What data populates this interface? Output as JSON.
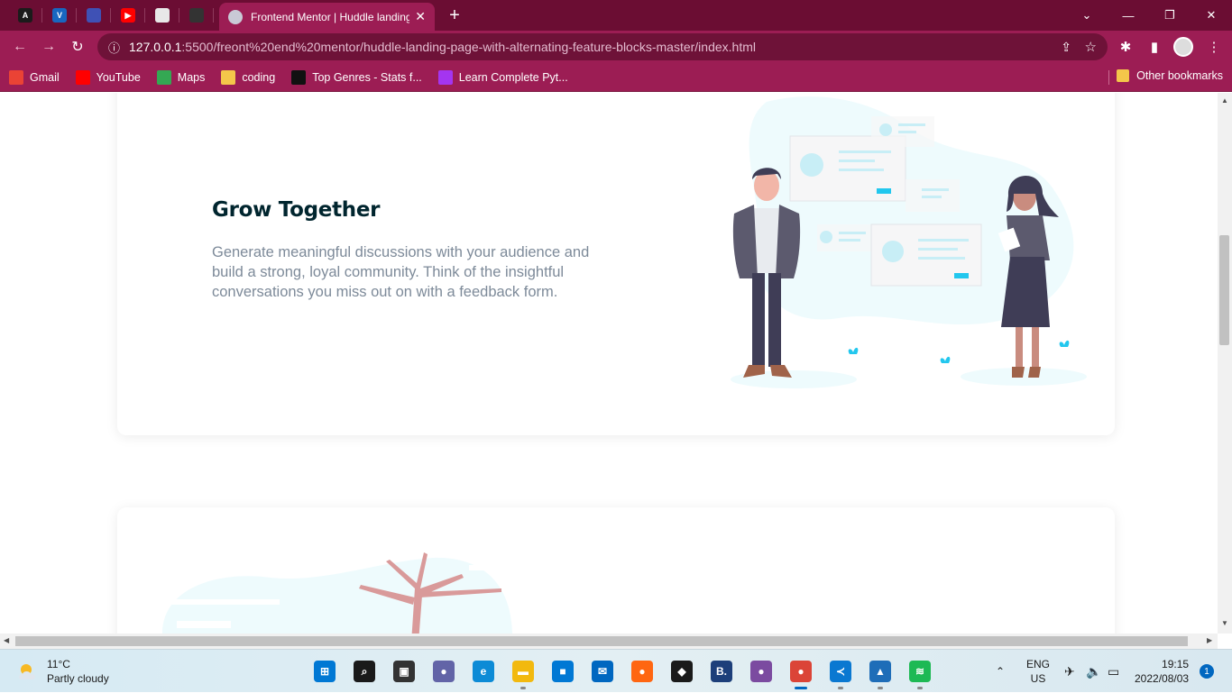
{
  "browser": {
    "active_tab": {
      "title": "Frontend Mentor | Huddle landing page with alternating feature blocks"
    },
    "pinned_tabs": [
      {
        "icon": "angular-icon",
        "color": "#1b1b1b",
        "glyph": "A"
      },
      {
        "icon": "vuetify-icon",
        "color": "#1867c0",
        "glyph": "V"
      },
      {
        "icon": "app-icon",
        "color": "#3f51b5",
        "glyph": ""
      },
      {
        "icon": "youtube-icon",
        "color": "#ff0000",
        "glyph": "▶"
      },
      {
        "icon": "page-icon",
        "color": "#e8e8e8",
        "glyph": ""
      },
      {
        "icon": "github-icon",
        "color": "#333333",
        "glyph": ""
      }
    ],
    "url_host": "127.0.0.1",
    "url_rest": ":5500/freont%20end%20mentor/huddle-landing-page-with-alternating-feature-blocks-master/index.html",
    "bookmarks": [
      {
        "label": "Gmail",
        "icon": "gmail-icon",
        "color": "#ea4335"
      },
      {
        "label": "YouTube",
        "icon": "youtube-icon",
        "color": "#ff0000"
      },
      {
        "label": "Maps",
        "icon": "maps-icon",
        "color": "#34a853"
      },
      {
        "label": "coding",
        "icon": "folder-icon",
        "color": "#f4c64a"
      },
      {
        "label": "Top Genres - Stats f...",
        "icon": "stats-icon",
        "color": "#111111"
      },
      {
        "label": "Learn Complete Pyt...",
        "icon": "udemy-icon",
        "color": "#a435f0"
      }
    ],
    "other_bookmarks": "Other bookmarks",
    "accent": "#9c1d54"
  },
  "page": {
    "feature": {
      "title": "Grow Together",
      "body": "Generate meaningful discussions with your audience and build a strong, loyal community. Think of the insightful conversations you miss out on with a feedback form."
    }
  },
  "taskbar": {
    "weather": {
      "temp": "11°C",
      "desc": "Partly cloudy"
    },
    "apps": [
      {
        "name": "start-icon",
        "color": "#0078d4",
        "glyph": "⊞",
        "state": ""
      },
      {
        "name": "search-icon",
        "color": "#1a1a1a",
        "glyph": "⌕",
        "state": ""
      },
      {
        "name": "task-view-icon",
        "color": "#333333",
        "glyph": "▣",
        "state": ""
      },
      {
        "name": "teams-chat-icon",
        "color": "#6264a7",
        "glyph": "●",
        "state": ""
      },
      {
        "name": "edge-icon",
        "color": "#0c8bd6",
        "glyph": "e",
        "state": ""
      },
      {
        "name": "file-explorer-icon",
        "color": "#f2b90f",
        "glyph": "▬",
        "state": "dot"
      },
      {
        "name": "store-icon",
        "color": "#0078d4",
        "glyph": "■",
        "state": ""
      },
      {
        "name": "mail-icon",
        "color": "#0067c0",
        "glyph": "✉",
        "state": ""
      },
      {
        "name": "firefox-icon",
        "color": "#ff6611",
        "glyph": "●",
        "state": ""
      },
      {
        "name": "dropbox-icon",
        "color": "#1a1a1a",
        "glyph": "◆",
        "state": ""
      },
      {
        "name": "bootstrap-studio-icon",
        "color": "#1d3f7a",
        "glyph": "B.",
        "state": ""
      },
      {
        "name": "github-desktop-icon",
        "color": "#7b4ba0",
        "glyph": "●",
        "state": ""
      },
      {
        "name": "chrome-icon",
        "color": "#db4437",
        "glyph": "●",
        "state": "bar"
      },
      {
        "name": "vscode-icon",
        "color": "#0a78d1",
        "glyph": "≺",
        "state": "dot"
      },
      {
        "name": "photos-icon",
        "color": "#1e6db8",
        "glyph": "▲",
        "state": "dot"
      },
      {
        "name": "spotify-icon",
        "color": "#1db954",
        "glyph": "≋",
        "state": "dot"
      }
    ],
    "lang": "ENG",
    "region": "US",
    "time": "19:15",
    "date": "2022/08/03",
    "notifications": "1"
  }
}
